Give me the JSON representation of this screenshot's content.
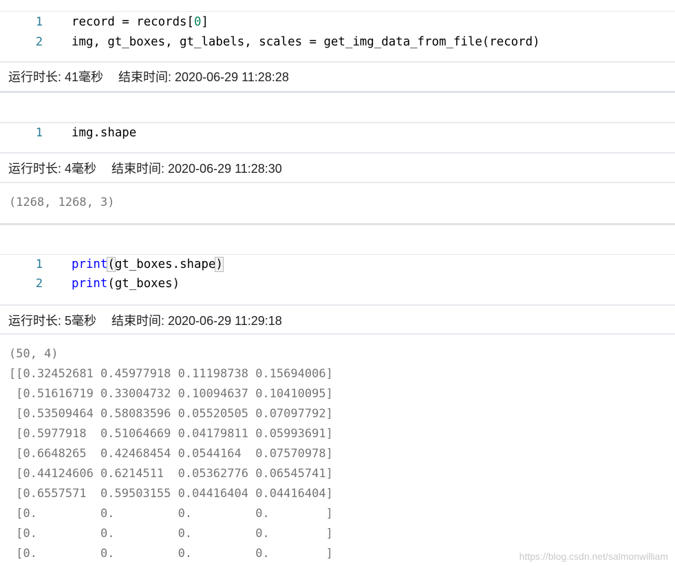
{
  "cells": [
    {
      "lines": [
        {
          "num": "1",
          "code": "record = records[0]"
        },
        {
          "num": "2",
          "code": "img, gt_boxes, gt_labels, scales = get_img_data_from_file(record)"
        }
      ],
      "status": {
        "duration_label": "运行时长: 41毫秒",
        "end_label": "结束时间: 2020-06-29 11:28:28"
      },
      "output": []
    },
    {
      "lines": [
        {
          "num": "1",
          "code": "img.shape"
        }
      ],
      "status": {
        "duration_label": "运行时长: 4毫秒",
        "end_label": "结束时间: 2020-06-29 11:28:30"
      },
      "output": [
        "(1268, 1268, 3)"
      ]
    },
    {
      "lines": [
        {
          "num": "1",
          "code": "print(gt_boxes.shape)"
        },
        {
          "num": "2",
          "code": "print(gt_boxes)"
        }
      ],
      "status": {
        "duration_label": "运行时长: 5毫秒",
        "end_label": "结束时间: 2020-06-29 11:29:18"
      },
      "output": [
        "(50, 4)",
        "[[0.32452681 0.45977918 0.11198738 0.15694006]",
        " [0.51616719 0.33004732 0.10094637 0.10410095]",
        " [0.53509464 0.58083596 0.05520505 0.07097792]",
        " [0.5977918  0.51064669 0.04179811 0.05993691]",
        " [0.6648265  0.42468454 0.0544164  0.07570978]",
        " [0.44124606 0.6214511  0.05362776 0.06545741]",
        " [0.6557571  0.59503155 0.04416404 0.04416404]",
        " [0.         0.         0.         0.        ]",
        " [0.         0.         0.         0.        ]",
        " [0.         0.         0.         0.        ]"
      ]
    }
  ],
  "watermark": "https://blog.csdn.net/salmonwilliam",
  "colors": {
    "line_number": "#237893",
    "keyword": "#0000ff",
    "number": "#098658",
    "output": "#757575"
  }
}
